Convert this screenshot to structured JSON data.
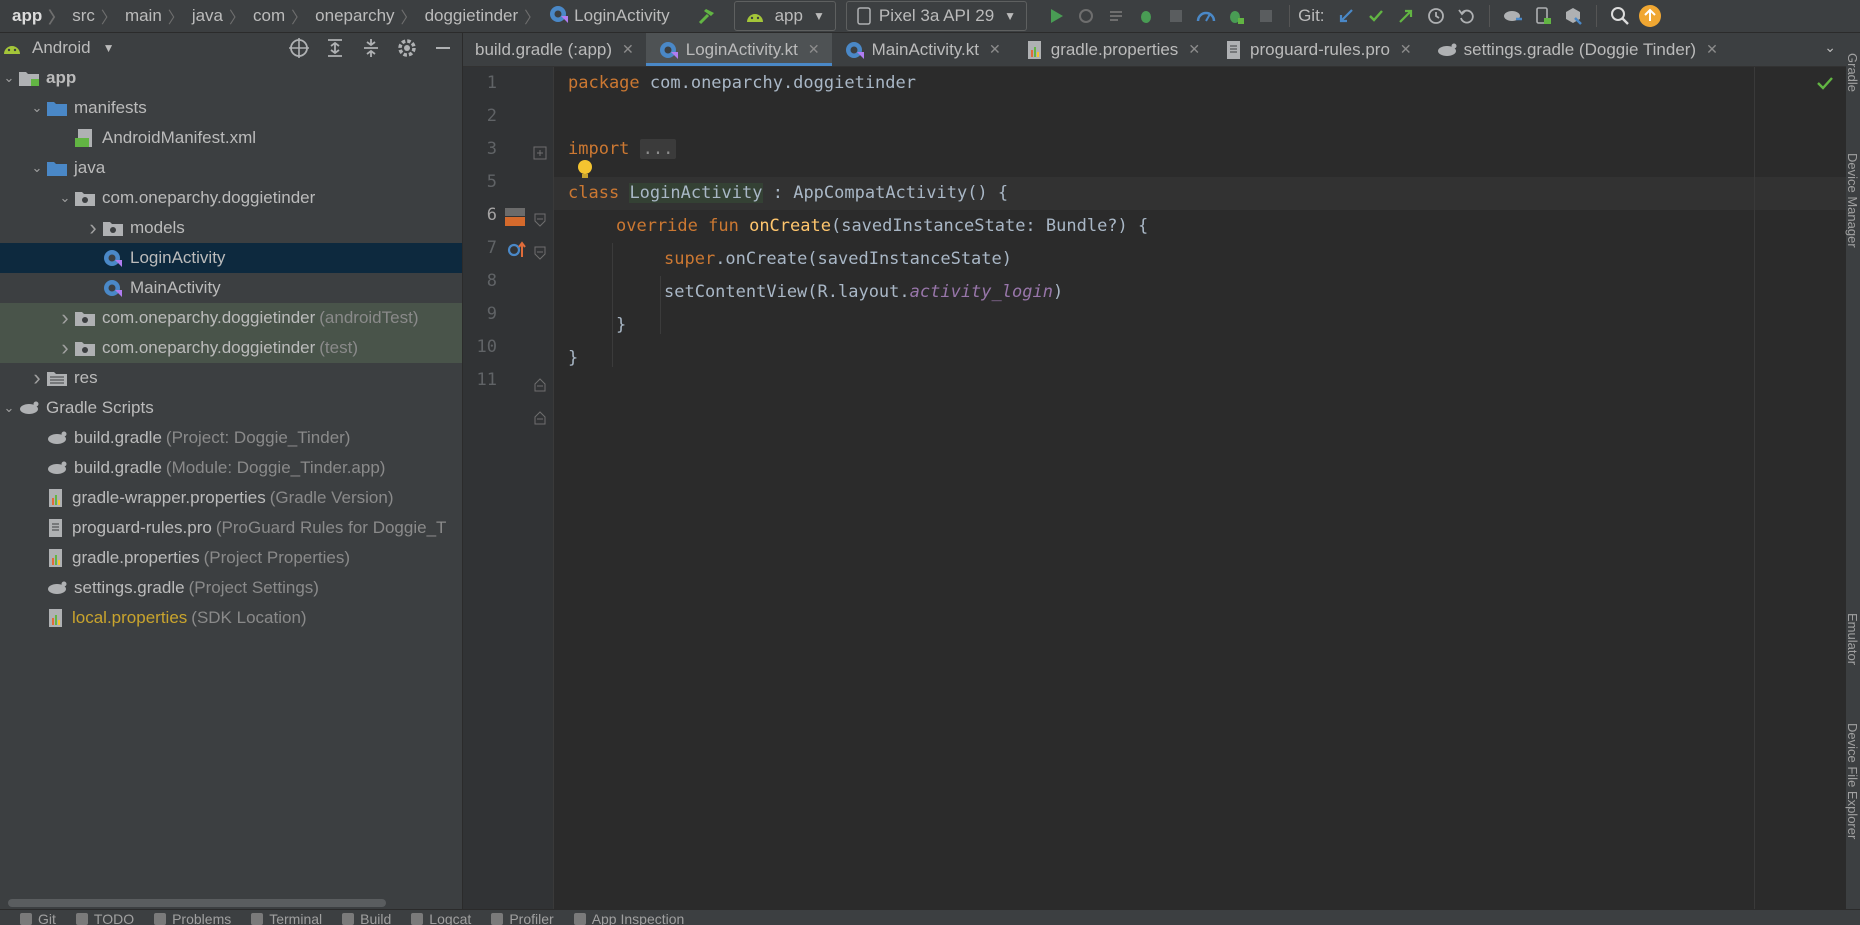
{
  "breadcrumbs": [
    "app",
    "src",
    "main",
    "java",
    "com",
    "oneparchy",
    "doggietinder",
    "LoginActivity"
  ],
  "toolbar": {
    "run_config": "app",
    "device": "Pixel 3a API 29",
    "git_label": "Git:"
  },
  "project_panel": {
    "view_label": "Android",
    "tree": [
      {
        "label": "app",
        "hint": "",
        "depth": 0,
        "arrow": "open",
        "icon": "module-icon",
        "style": "bold"
      },
      {
        "label": "manifests",
        "hint": "",
        "depth": 1,
        "arrow": "open",
        "icon": "folder-icon",
        "style": ""
      },
      {
        "label": "AndroidManifest.xml",
        "hint": "",
        "depth": 2,
        "arrow": "none",
        "icon": "manifest-file-icon",
        "style": ""
      },
      {
        "label": "java",
        "hint": "",
        "depth": 1,
        "arrow": "open",
        "icon": "folder-icon",
        "style": ""
      },
      {
        "label": "com.oneparchy.doggietinder",
        "hint": "",
        "depth": 2,
        "arrow": "open",
        "icon": "package-icon",
        "style": ""
      },
      {
        "label": "models",
        "hint": "",
        "depth": 3,
        "arrow": "closed",
        "icon": "package-icon",
        "style": ""
      },
      {
        "label": "LoginActivity",
        "hint": "",
        "depth": 3,
        "arrow": "none",
        "icon": "kotlin-class-icon",
        "style": "selected"
      },
      {
        "label": "MainActivity",
        "hint": "",
        "depth": 3,
        "arrow": "none",
        "icon": "kotlin-class-icon",
        "style": ""
      },
      {
        "label": "com.oneparchy.doggietinder",
        "hint": "(androidTest)",
        "depth": 2,
        "arrow": "closed",
        "icon": "package-icon",
        "style": "test"
      },
      {
        "label": "com.oneparchy.doggietinder",
        "hint": "(test)",
        "depth": 2,
        "arrow": "closed",
        "icon": "package-icon",
        "style": "test"
      },
      {
        "label": "res",
        "hint": "",
        "depth": 1,
        "arrow": "closed",
        "icon": "res-folder-icon",
        "style": ""
      },
      {
        "label": "Gradle Scripts",
        "hint": "",
        "depth": 0,
        "arrow": "open",
        "icon": "gradle-icon",
        "style": ""
      },
      {
        "label": "build.gradle",
        "hint": "(Project: Doggie_Tinder)",
        "depth": 1,
        "arrow": "none",
        "icon": "gradle-icon",
        "style": ""
      },
      {
        "label": "build.gradle",
        "hint": "(Module: Doggie_Tinder.app)",
        "depth": 1,
        "arrow": "none",
        "icon": "gradle-icon",
        "style": ""
      },
      {
        "label": "gradle-wrapper.properties",
        "hint": "(Gradle Version)",
        "depth": 1,
        "arrow": "none",
        "icon": "properties-icon",
        "style": ""
      },
      {
        "label": "proguard-rules.pro",
        "hint": "(ProGuard Rules for Doggie_T",
        "depth": 1,
        "arrow": "none",
        "icon": "text-file-icon",
        "style": ""
      },
      {
        "label": "gradle.properties",
        "hint": "(Project Properties)",
        "depth": 1,
        "arrow": "none",
        "icon": "properties-icon",
        "style": ""
      },
      {
        "label": "settings.gradle",
        "hint": "(Project Settings)",
        "depth": 1,
        "arrow": "none",
        "icon": "gradle-icon",
        "style": ""
      },
      {
        "label": "local.properties",
        "hint": "(SDK Location)",
        "depth": 1,
        "arrow": "none",
        "icon": "properties-icon",
        "style": "modified"
      }
    ]
  },
  "tabs": [
    {
      "label": "build.gradle (:app)",
      "icon": "",
      "active": false
    },
    {
      "label": "LoginActivity.kt",
      "icon": "kotlin-class-icon",
      "active": true
    },
    {
      "label": "MainActivity.kt",
      "icon": "kotlin-class-icon",
      "active": false
    },
    {
      "label": "gradle.properties",
      "icon": "properties-icon",
      "active": false
    },
    {
      "label": "proguard-rules.pro",
      "icon": "text-file-icon",
      "active": false
    },
    {
      "label": "settings.gradle (Doggie Tinder)",
      "icon": "gradle-icon",
      "active": false
    }
  ],
  "editor": {
    "line_numbers": [
      "1",
      "2",
      "3",
      "5",
      "6",
      "7",
      "8",
      "9",
      "10",
      "11"
    ],
    "code": {
      "l1_kw": "package",
      "l1_rest": " com.oneparchy.doggietinder",
      "l3_kw": "import",
      "l3_fold": "...",
      "l6_kw": "class",
      "l6_name": "LoginActivity",
      "l6_rest": " : AppCompatActivity() {",
      "l7_kw1": "override",
      "l7_kw2": " fun ",
      "l7_fn": "onCreate",
      "l7_rest": "(savedInstanceState: Bundle?) {",
      "l8_kw": "super",
      "l8_rest": ".onCreate(savedInstanceState)",
      "l9_pre": "setContentView(R.layout.",
      "l9_it": "activity_login",
      "l9_post": ")",
      "l10": "}",
      "l11": "}"
    }
  },
  "right_strip": [
    "Gradle",
    "Device Manager",
    "Emulator",
    "Device File Explorer"
  ],
  "bottom_tools": [
    "Git",
    "TODO",
    "Problems",
    "Terminal",
    "Build",
    "Logcat",
    "Profiler",
    "App Inspection"
  ]
}
